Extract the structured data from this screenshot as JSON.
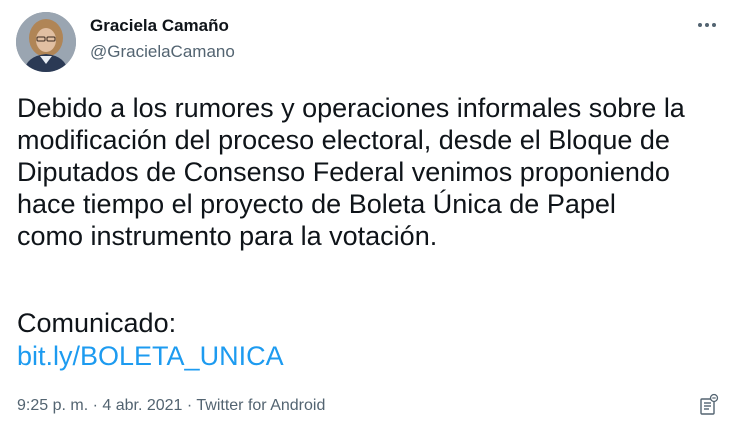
{
  "author": {
    "display_name": "Graciela Camaño",
    "handle": "@GracielaCamano",
    "avatar_icon": "profile-photo"
  },
  "tweet": {
    "text": "Debido a los rumores y operaciones informales sobre la\nmodificación del proceso electoral, desde el Bloque de\nDiputados de Consenso Federal venimos proponiendo\nhace tiempo el proyecto de Boleta Única de Papel\ncomo instrumento para la votación.",
    "communicated_label": "Comunicado:",
    "link_text": "bit.ly/BOLETA_UNICA"
  },
  "meta": {
    "time": "9:25 p. m.",
    "separator1": " · ",
    "date": "4 abr. 2021",
    "separator2": " · ",
    "source": "Twitter for Android"
  },
  "icons": {
    "more": "more-horizontal-icon",
    "info": "tweet-info-icon"
  },
  "colors": {
    "text": "#0f1419",
    "secondary": "#536471",
    "link": "#1d9bf0"
  }
}
